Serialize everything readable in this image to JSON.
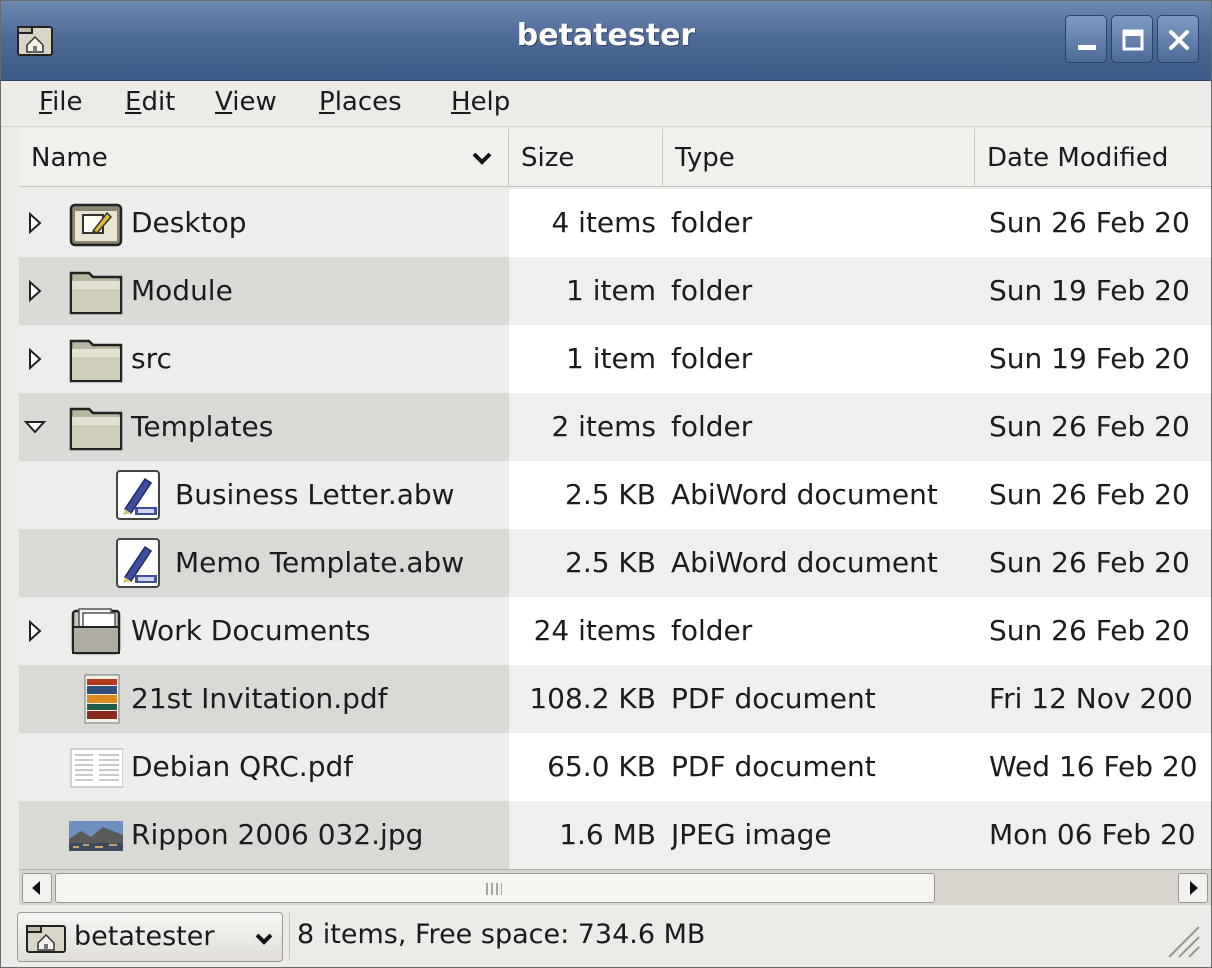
{
  "window": {
    "title": "betatester"
  },
  "menu": [
    {
      "label": "File",
      "mnemonic": "F",
      "rest": "ile"
    },
    {
      "label": "Edit",
      "mnemonic": "E",
      "rest": "dit"
    },
    {
      "label": "View",
      "mnemonic": "V",
      "rest": "iew"
    },
    {
      "label": "Places",
      "mnemonic": "P",
      "rest": "laces"
    },
    {
      "label": "Help",
      "mnemonic": "H",
      "rest": "elp"
    }
  ],
  "columns": {
    "name": "Name",
    "size": "Size",
    "type": "Type",
    "date": "Date Modified"
  },
  "rows": [
    {
      "name": "Desktop",
      "size": "4 items",
      "type": "folder",
      "date": "Sun 26 Feb 20",
      "icon": "desktop-folder-icon",
      "expander": "collapsed",
      "depth": 0
    },
    {
      "name": "Module",
      "size": "1 item",
      "type": "folder",
      "date": "Sun 19 Feb 20",
      "icon": "folder-icon",
      "expander": "collapsed",
      "depth": 0
    },
    {
      "name": "src",
      "size": "1 item",
      "type": "folder",
      "date": "Sun 19 Feb 20",
      "icon": "folder-icon",
      "expander": "collapsed",
      "depth": 0
    },
    {
      "name": "Templates",
      "size": "2 items",
      "type": "folder",
      "date": "Sun 26 Feb 20",
      "icon": "folder-icon",
      "expander": "expanded",
      "depth": 0
    },
    {
      "name": "Business Letter.abw",
      "size": "2.5 KB",
      "type": "AbiWord document",
      "date": "Sun 26 Feb 20",
      "icon": "abiword-document-icon",
      "expander": "none",
      "depth": 1
    },
    {
      "name": "Memo Template.abw",
      "size": "2.5 KB",
      "type": "AbiWord document",
      "date": "Sun 26 Feb 20",
      "icon": "abiword-document-icon",
      "expander": "none",
      "depth": 1
    },
    {
      "name": "Work Documents",
      "size": "24 items",
      "type": "folder",
      "date": "Sun 26 Feb 20",
      "icon": "documents-folder-icon",
      "expander": "collapsed",
      "depth": 0
    },
    {
      "name": "21st Invitation.pdf",
      "size": "108.2 KB",
      "type": "PDF document",
      "date": "Fri 12 Nov 200",
      "icon": "pdf-thumbnail-icon",
      "expander": "none",
      "depth": 0
    },
    {
      "name": "Debian QRC.pdf",
      "size": "65.0 KB",
      "type": "PDF document",
      "date": "Wed 16 Feb 20",
      "icon": "pdf-document-icon",
      "expander": "none",
      "depth": 0
    },
    {
      "name": "Rippon 2006 032.jpg",
      "size": "1.6 MB",
      "type": "JPEG image",
      "date": "Mon 06 Feb 20",
      "icon": "jpeg-thumbnail-icon",
      "expander": "none",
      "depth": 0
    }
  ],
  "statusbar": {
    "location": "betatester",
    "summary": "8 items, Free space: 734.6 MB"
  },
  "colors": {
    "titlebar": "#4f6b97",
    "name_column_even": "#d9d9d5",
    "name_column_odd": "#ededeb"
  }
}
